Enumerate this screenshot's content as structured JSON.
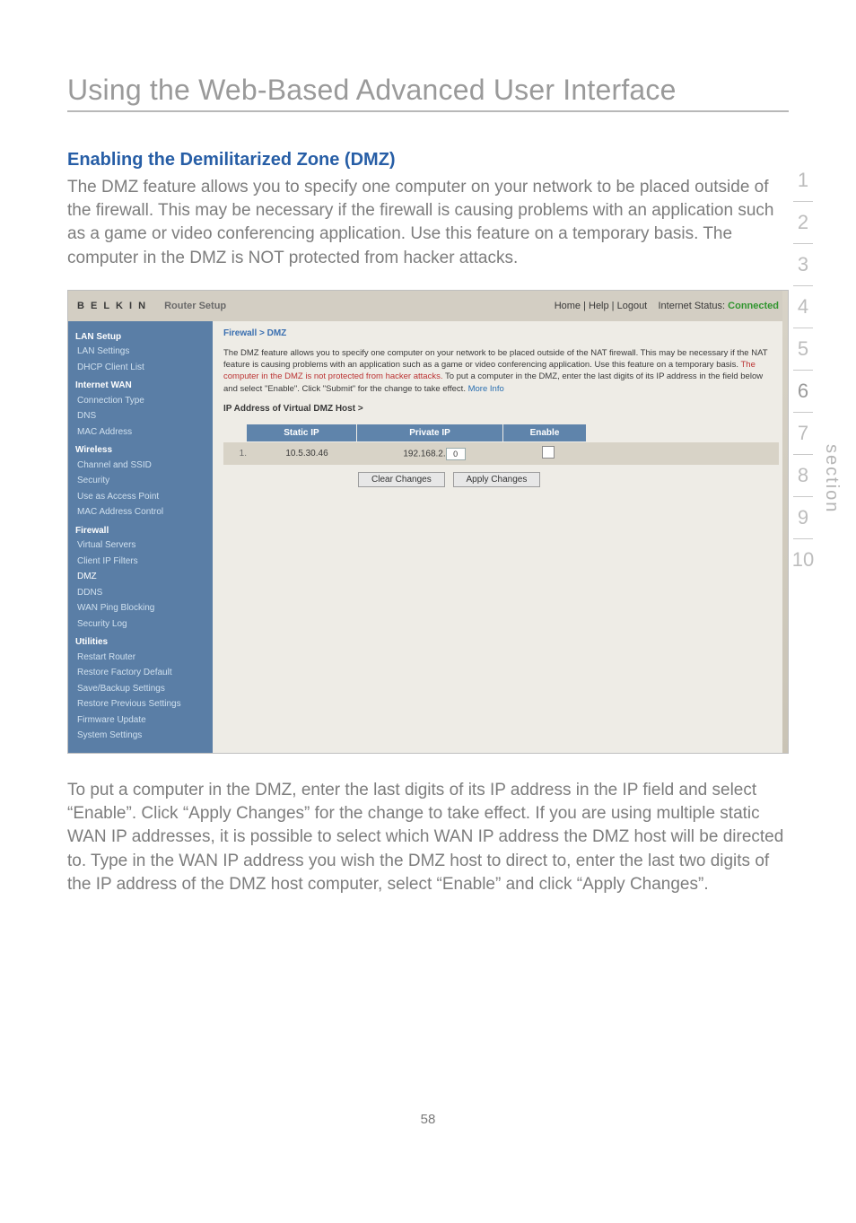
{
  "page": {
    "title": "Using the Web-Based Advanced User Interface",
    "section_heading": "Enabling the Demilitarized Zone (DMZ)",
    "intro": "The DMZ feature allows you to specify one computer on your network to be placed outside of the firewall. This may be necessary if the firewall is causing problems with an application such as a game or video conferencing application. Use this feature on a temporary basis. The computer in the DMZ is NOT protected from hacker attacks.",
    "after_text": "To put a computer in the DMZ, enter the last digits of its IP address in the IP field and select “Enable”. Click “Apply Changes” for the change to take effect. If you are using multiple static WAN IP addresses, it is possible to select which WAN IP address the DMZ host will be directed to. Type in the WAN IP address you wish the DMZ host to direct to, enter the last two digits of the IP address of the DMZ host computer, select “Enable” and click “Apply Changes”.",
    "page_number": "58",
    "section_word": "section"
  },
  "rail": {
    "items": [
      "1",
      "2",
      "3",
      "4",
      "5",
      "6",
      "7",
      "8",
      "9",
      "10"
    ],
    "active_index": 5
  },
  "screenshot": {
    "brand": "B E L K I N",
    "setup_title": "Router Setup",
    "status_links": "Home | Help | Logout",
    "status_label": "Internet Status:",
    "status_value": "Connected",
    "sidebar": {
      "groups": [
        {
          "title": "LAN Setup",
          "items": [
            "LAN Settings",
            "DHCP Client List"
          ]
        },
        {
          "title": "Internet WAN",
          "items": [
            "Connection Type",
            "DNS",
            "MAC Address"
          ]
        },
        {
          "title": "Wireless",
          "items": [
            "Channel and SSID",
            "Security",
            "Use as Access Point",
            "MAC Address Control"
          ]
        },
        {
          "title": "Firewall",
          "items": [
            "Virtual Servers",
            "Client IP Filters",
            "DMZ",
            "DDNS",
            "WAN Ping Blocking",
            "Security Log"
          ]
        },
        {
          "title": "Utilities",
          "items": [
            "Restart Router",
            "Restore Factory Default",
            "Save/Backup Settings",
            "Restore Previous Settings",
            "Firmware Update",
            "System Settings"
          ]
        }
      ],
      "active": "DMZ"
    },
    "content": {
      "breadcrumb": "Firewall > DMZ",
      "desc_part1": "The DMZ feature allows you to specify one computer on your network to be placed outside of the NAT firewall. This may be necessary if the NAT feature is causing problems with an application such as a game or video conferencing application. Use this feature on a temporary basis. ",
      "desc_warn": "The computer in the DMZ is not protected from hacker attacks.",
      "desc_part2": " To put a computer in the DMZ, enter the last digits of its IP address in the field below and select \"Enable\". Click \"Submit\" for the change to take effect. ",
      "desc_more": "More Info",
      "table_caption": "IP Address of Virtual DMZ Host >",
      "headers": {
        "static": "Static IP",
        "private": "Private IP",
        "enable": "Enable"
      },
      "row": {
        "index": "1.",
        "static_ip": "10.5.30.46",
        "private_prefix": "192.168.2.",
        "private_last": "0"
      },
      "buttons": {
        "clear": "Clear Changes",
        "apply": "Apply Changes"
      }
    }
  }
}
